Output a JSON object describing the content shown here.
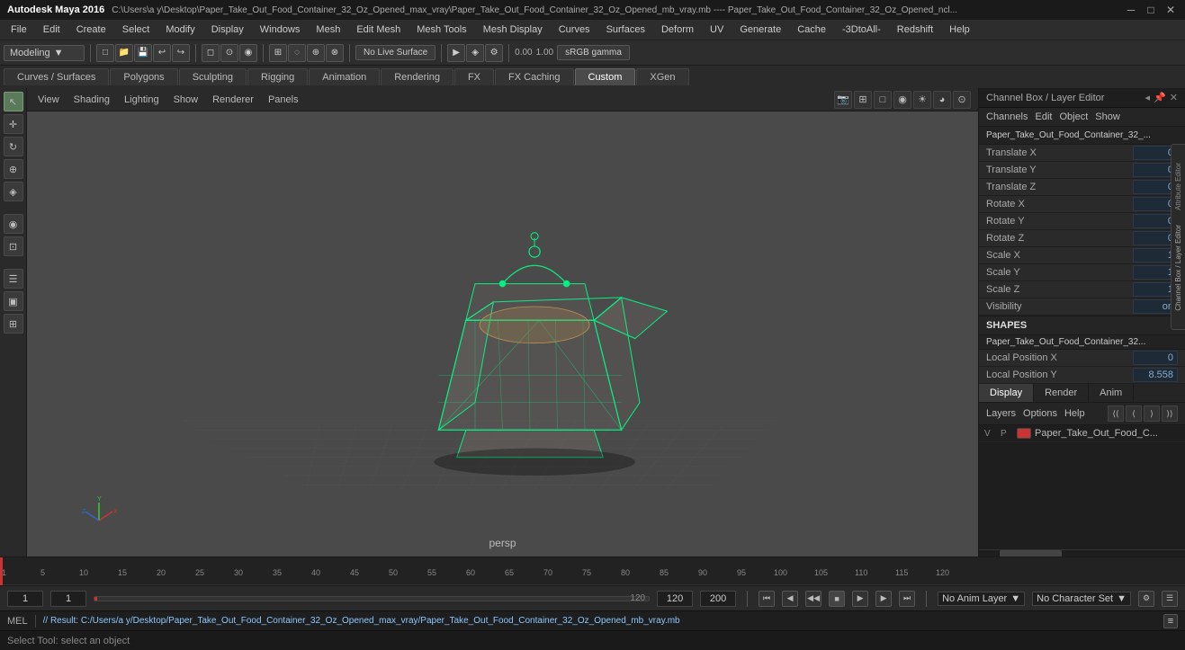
{
  "titlebar": {
    "logo": "Autodesk Maya 2016",
    "title": "C:\\Users\\a y\\Desktop\\Paper_Take_Out_Food_Container_32_Oz_Opened_max_vray\\Paper_Take_Out_Food_Container_32_Oz_Opened_mb_vray.mb ---- Paper_Take_Out_Food_Container_32_Oz_Opened_ncl...",
    "minimize": "─",
    "maximize": "□",
    "close": "✕"
  },
  "menubar": {
    "items": [
      "File",
      "Edit",
      "Create",
      "Select",
      "Modify",
      "Display",
      "Windows",
      "Mesh",
      "Edit Mesh",
      "Mesh Tools",
      "Mesh Display",
      "Curves",
      "Surfaces",
      "Deform",
      "UV",
      "Generate",
      "Cache",
      "-3DtoAll-",
      "Redshift",
      "Help"
    ]
  },
  "toolbar1": {
    "workspace_label": "Modeling",
    "live_surface": "No Live Surface",
    "icons": [
      "□",
      "↩",
      "↪",
      "▶",
      "◀",
      "↔",
      "⊕",
      "⊙",
      "⊗",
      "◈",
      "⊞"
    ]
  },
  "tabs": {
    "items": [
      "Curves / Surfaces",
      "Polygons",
      "Sculpting",
      "Rigging",
      "Animation",
      "Rendering",
      "FX",
      "FX Caching",
      "Custom",
      "XGen"
    ],
    "active": "Custom"
  },
  "viewport": {
    "menus": [
      "View",
      "Shading",
      "Lighting",
      "Show",
      "Renderer",
      "Panels"
    ],
    "camera_label": "persp",
    "gamma_value": "0.00",
    "gamma_exposure": "1.00",
    "color_profile": "sRGB gamma"
  },
  "channel_box": {
    "title": "Channel Box / Layer Editor",
    "menus": [
      "Channels",
      "Edit",
      "Object",
      "Show"
    ],
    "object_name": "Paper_Take_Out_Food_Container_32_...",
    "channels": [
      {
        "label": "Translate X",
        "value": "0"
      },
      {
        "label": "Translate Y",
        "value": "0"
      },
      {
        "label": "Translate Z",
        "value": "0"
      },
      {
        "label": "Rotate X",
        "value": "0"
      },
      {
        "label": "Rotate Y",
        "value": "0"
      },
      {
        "label": "Rotate Z",
        "value": "0"
      },
      {
        "label": "Scale X",
        "value": "1"
      },
      {
        "label": "Scale Y",
        "value": "1"
      },
      {
        "label": "Scale Z",
        "value": "1"
      },
      {
        "label": "Visibility",
        "value": "on"
      }
    ],
    "shapes_label": "SHAPES",
    "shapes_object": "Paper_Take_Out_Food_Container_32...",
    "shapes_channels": [
      {
        "label": "Local Position X",
        "value": "0"
      },
      {
        "label": "Local Position Y",
        "value": "8.558"
      }
    ],
    "layer_tabs": [
      "Display",
      "Render",
      "Anim"
    ],
    "active_layer_tab": "Display",
    "layer_menus": [
      "Layers",
      "Options",
      "Help"
    ],
    "layer_arrows": [
      "⟨⟨",
      "⟨",
      "⟩",
      "⟩⟩"
    ],
    "layers": [
      {
        "v": "V",
        "p": "P",
        "color": "#cc3333",
        "name": "Paper_Take_Out_Food_C..."
      }
    ],
    "layer_scroll": 30
  },
  "timeline": {
    "start": "1",
    "end": "120",
    "current": "1",
    "range_end": "200",
    "marks": [
      "1",
      "5",
      "10",
      "15",
      "20",
      "25",
      "30",
      "35",
      "40",
      "45",
      "50",
      "55",
      "60",
      "65",
      "70",
      "75",
      "80",
      "85",
      "90",
      "95",
      "100",
      "105",
      "110",
      "115",
      "120"
    ],
    "anim_layer": "No Anim Layer",
    "char_set": "No Character Set"
  },
  "playback": {
    "current_frame": "1",
    "start_frame": "1",
    "frame_indicator": "1",
    "end_frame": "120",
    "range_end_frame": "200",
    "buttons": [
      "⏮",
      "⏭",
      "◀◀",
      "◀",
      "⏹",
      "▶",
      "▶▶",
      "⏭"
    ]
  },
  "statusbar": {
    "mode": "MEL",
    "result_text": "// Result: C:/Users/a y/Desktop/Paper_Take_Out_Food_Container_32_Oz_Opened_max_vray/Paper_Take_Out_Food_Container_32_Oz_Opened_mb_vray.mb",
    "bottom_hint": "Select Tool: select an object"
  },
  "side_tools": {
    "buttons": [
      "▶",
      "↔",
      "↻",
      "⊕",
      "◈",
      "⊞",
      "☰",
      "▣",
      "⊟",
      "⊞",
      "▤"
    ]
  },
  "colors": {
    "accent_blue": "#5588aa",
    "active_green": "#5a7a5a",
    "bg_dark": "#1e1e1e",
    "bg_mid": "#2a2a2a",
    "bg_light": "#3a3a3a",
    "text_normal": "#cccccc",
    "text_dim": "#888888",
    "model_green": "#00ff88"
  },
  "right_edge": {
    "label1": "Attribute Editor",
    "label2": "Channel Box / Layer Editor"
  }
}
